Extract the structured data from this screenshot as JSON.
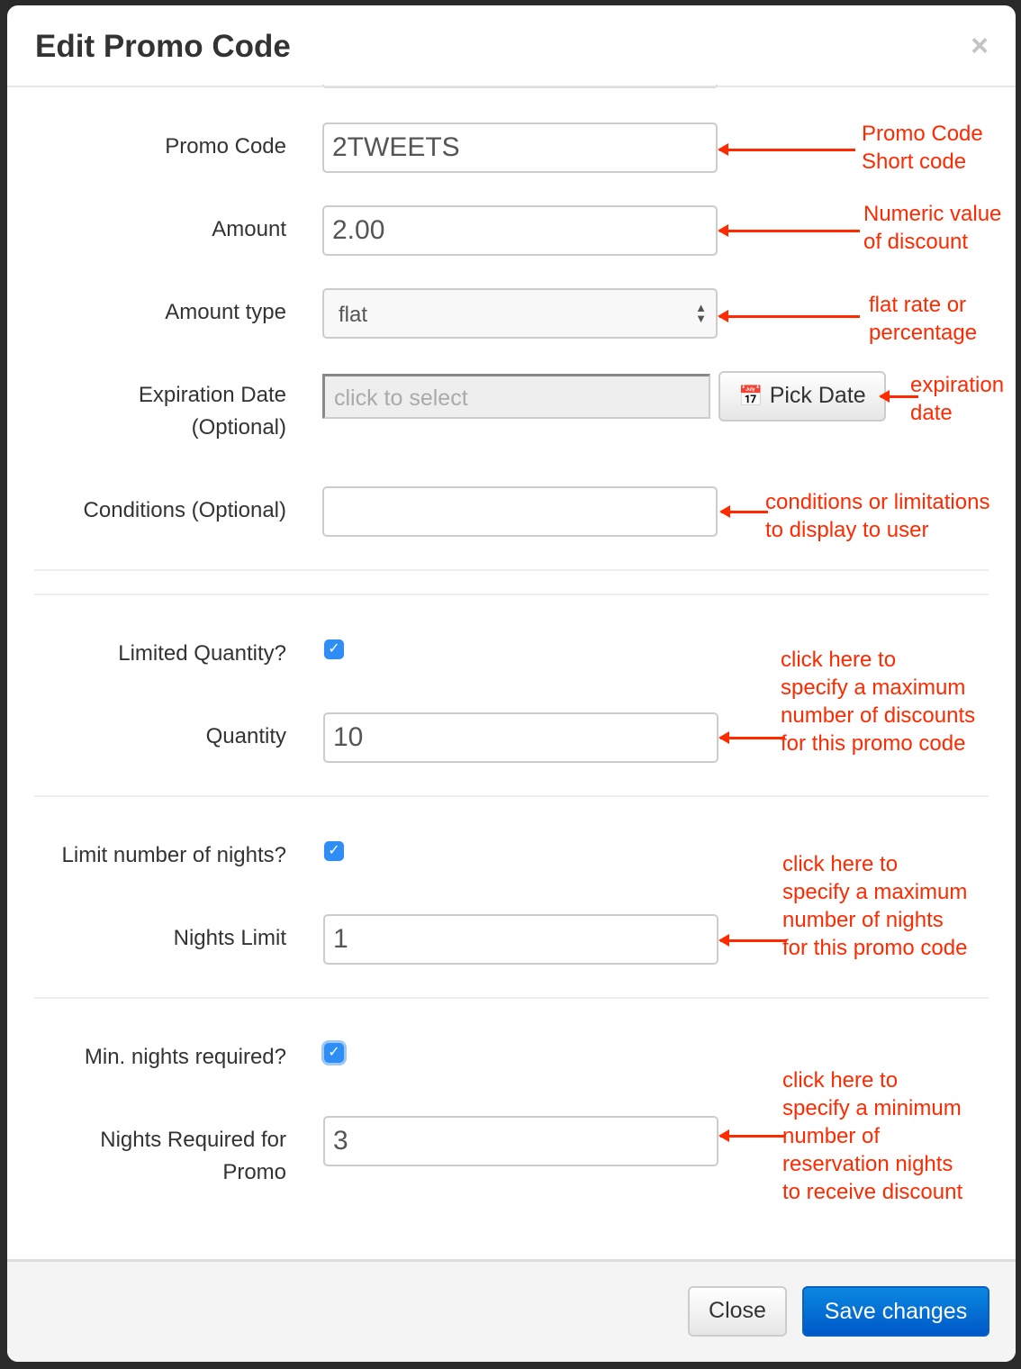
{
  "modal": {
    "title": "Edit Promo Code",
    "close_icon": "×"
  },
  "fields": {
    "promo_code": {
      "label": "Promo Code",
      "value": "2TWEETS"
    },
    "amount": {
      "label": "Amount",
      "value": "2.00"
    },
    "amount_type": {
      "label": "Amount type",
      "value": "flat"
    },
    "expiration": {
      "label1": "Expiration Date",
      "label2": "(Optional)",
      "placeholder": "click to select",
      "button": "Pick Date"
    },
    "conditions": {
      "label": "Conditions (Optional)",
      "value": ""
    },
    "limited_quantity": {
      "label": "Limited Quantity?",
      "checked": true
    },
    "quantity": {
      "label": "Quantity",
      "value": "10"
    },
    "limit_nights": {
      "label": "Limit number of nights?",
      "checked": true
    },
    "nights_limit": {
      "label": "Nights Limit",
      "value": "1"
    },
    "min_nights": {
      "label": "Min. nights required?",
      "checked": true
    },
    "nights_required": {
      "label1": "Nights Required for",
      "label2": "Promo",
      "value": "3"
    }
  },
  "annotations": {
    "promo_code": [
      "Promo Code",
      "Short code"
    ],
    "amount": [
      "Numeric value",
      "of discount"
    ],
    "amount_type": [
      "flat rate or",
      "percentage"
    ],
    "expiration": [
      "expiration",
      "date"
    ],
    "conditions": [
      "conditions or limitations",
      "to display to user"
    ],
    "quantity": [
      "click here to",
      "specify a maximum",
      "number of discounts",
      "for this promo code"
    ],
    "nights": [
      "click here to",
      "specify a maximum",
      "number of nights",
      "for this promo code"
    ],
    "min_nights": [
      "click here to",
      "specify a minimum",
      "number of",
      "reservation nights",
      "to receive discount"
    ]
  },
  "footer": {
    "close": "Close",
    "save": "Save changes"
  },
  "colors": {
    "annotation": "#ff2a00",
    "primary": "#0a6fd6"
  }
}
